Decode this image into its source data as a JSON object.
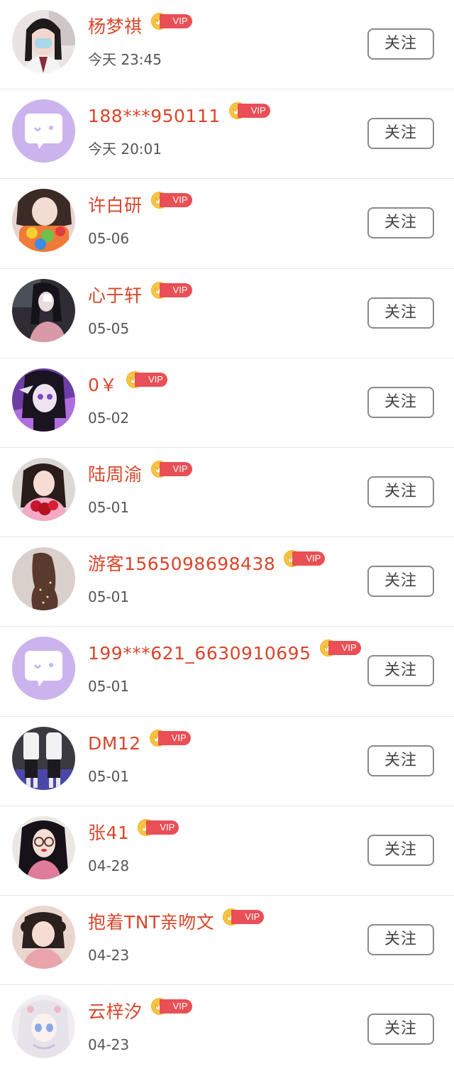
{
  "follow_label": "关注",
  "vip_label": "VIP",
  "colors": {
    "name": "#d9462b",
    "vip_pill": "#e94f55",
    "vip_crown": "#f7c544",
    "default_avatar": "#cbb3ee"
  },
  "users": [
    {
      "name": "杨梦祺",
      "time": "今天 23:45",
      "avatar": "photo-girl-mask",
      "vip": true
    },
    {
      "name": "188***950111",
      "time": "今天 20:01",
      "avatar": "default-chat-icon",
      "vip": true
    },
    {
      "name": "许白研",
      "time": "05-06",
      "avatar": "photo-girl-food",
      "vip": true
    },
    {
      "name": "心于轩",
      "time": "05-05",
      "avatar": "photo-girl-dark",
      "vip": true
    },
    {
      "name": "0￥",
      "time": "05-02",
      "avatar": "anime-purple",
      "vip": true
    },
    {
      "name": "陆周渝",
      "time": "05-01",
      "avatar": "photo-girl-flowers",
      "vip": true
    },
    {
      "name": "游客1565098698438",
      "time": "05-01",
      "avatar": "photo-dress",
      "vip": true
    },
    {
      "name": "199***621_6630910695",
      "time": "05-01",
      "avatar": "default-chat-icon",
      "vip": true
    },
    {
      "name": "DM12",
      "time": "05-01",
      "avatar": "photo-couple",
      "vip": true
    },
    {
      "name": "张41",
      "time": "04-28",
      "avatar": "photo-girl-glasses",
      "vip": true
    },
    {
      "name": "抱着TNT亲吻文",
      "time": "04-23",
      "avatar": "photo-girl-pink",
      "vip": true
    },
    {
      "name": "云梓汐",
      "time": "04-23",
      "avatar": "anime-white",
      "vip": true
    }
  ]
}
